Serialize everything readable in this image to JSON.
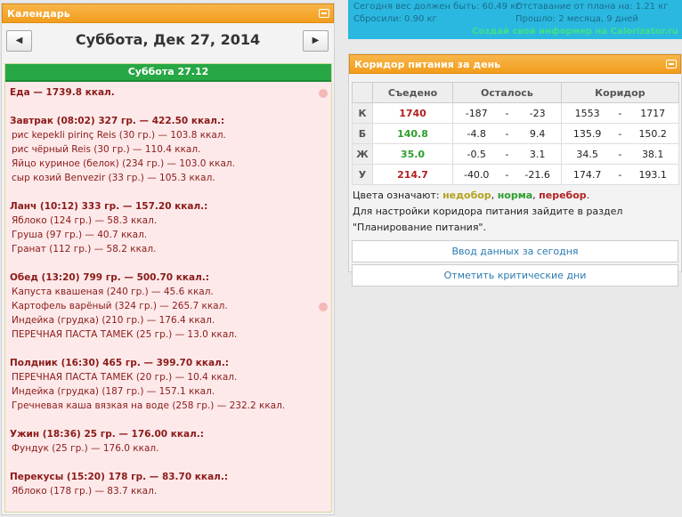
{
  "calendar": {
    "title": "Календарь",
    "prev": "◀",
    "next": "▶",
    "date": "Суббота, Дек 27, 2014",
    "day_header": "Суббота 27.12"
  },
  "day": {
    "total": "Еда — 1739.8 ккал.",
    "meals": [
      {
        "head": "Завтрак (08:02) 327 гр. — 422.50 ккал.:",
        "items": [
          "рис kepekli pirinç Reis (30 гр.) — 103.8 ккал.",
          "рис чёрный Reis (30 гр.) — 110.4 ккал.",
          "Яйцо куриное (белок) (234 гр.) — 103.0 ккал.",
          "сыр козий Benvezir (33 гр.) — 105.3 ккал."
        ]
      },
      {
        "head": "Ланч (10:12) 333 гр. — 157.20 ккал.:",
        "items": [
          "Яблоко (124 гр.) — 58.3 ккал.",
          "Груша (97 гр.) — 40.7 ккал.",
          "Гранат (112 гр.) — 58.2 ккал."
        ]
      },
      {
        "head": "Обед (13:20) 799 гр. — 500.70 ккал.:",
        "items": [
          "Капуста квашеная (240 гр.) — 45.6 ккал.",
          "Картофель варёный (324 гр.) — 265.7 ккал.",
          "Индейка (грудка) (210 гр.) — 176.4 ккал.",
          "ПЕРЕЧНАЯ ПАСТА ТАМЕК (25 гр.) — 13.0 ккал."
        ]
      },
      {
        "head": "Полдник (16:30) 465 гр. — 399.70 ккал.:",
        "items": [
          "ПЕРЕЧНАЯ ПАСТА ТАМЕК (20 гр.) — 10.4 ккал.",
          "Индейка (грудка) (187 гр.) — 157.1 ккал.",
          "Гречневая каша вязкая на воде (258 гр.) — 232.2 ккал."
        ]
      },
      {
        "head": "Ужин (18:36) 25 гр. — 176.00 ккал.:",
        "items": [
          "Фундук (25 гр.) — 176.0 ккал."
        ]
      },
      {
        "head": "Перекусы (15:20) 178 гр. — 83.70 ккал.:",
        "items": [
          "Яблоко (178 гр.) — 83.7 ккал."
        ]
      }
    ]
  },
  "goal": {
    "weight_today": "Сегодня вес должен быть: 60.49 кг",
    "lag": "Отставание от плана на: 1.21 кг",
    "lost": "Сбросили: 0.90 кг",
    "elapsed": "Прошло: 2 месяца, 9 дней",
    "link": "Создай свой информер на Calorizator.ru"
  },
  "corridor": {
    "title": "Коридор питания за день",
    "headers": [
      "Съедено",
      "Осталось",
      "Коридор"
    ],
    "rows": [
      {
        "lbl": "К",
        "eaten": "1740",
        "left1": "-187",
        "sep1": "-",
        "left2": "-23",
        "c1": "1553",
        "sep2": "-",
        "c2": "1717",
        "color": "#b22222"
      },
      {
        "lbl": "Б",
        "eaten": "140.8",
        "left1": "-4.8",
        "sep1": "-",
        "left2": "9.4",
        "c1": "135.9",
        "sep2": "-",
        "c2": "150.2",
        "color": "#2e9e2e"
      },
      {
        "lbl": "Ж",
        "eaten": "35.0",
        "left1": "-0.5",
        "sep1": "-",
        "left2": "3.1",
        "c1": "34.5",
        "sep2": "-",
        "c2": "38.1",
        "color": "#2e9e2e"
      },
      {
        "lbl": "У",
        "eaten": "214.7",
        "left1": "-40.0",
        "sep1": "-",
        "left2": "-21.6",
        "c1": "174.7",
        "sep2": "-",
        "c2": "193.1",
        "color": "#b22222"
      }
    ],
    "legend_prefix": "Цвета означают: ",
    "legend_under": "недобор",
    "legend_norm": "норма",
    "legend_over": "перебор",
    "legend_comma": ", ",
    "legend_dot": ".",
    "note1": "Для настройки коридора питания зайдите в раздел",
    "note2": "\"Планирование питания\".",
    "btn_input": "Ввод данных за сегодня",
    "btn_crit": "Отметить критические дни"
  }
}
